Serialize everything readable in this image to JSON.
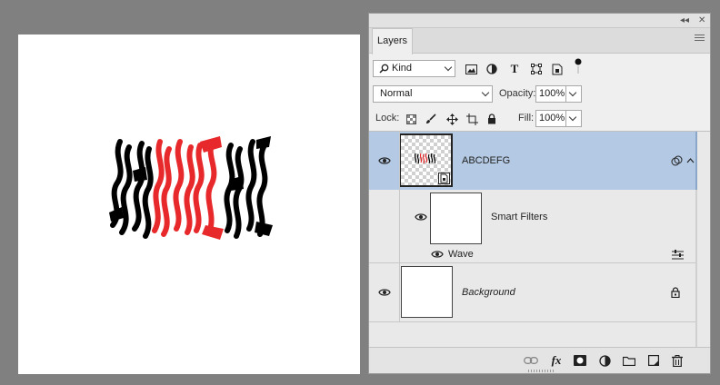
{
  "panel": {
    "collapse_glyph": "◂◂",
    "close_glyph": "✕",
    "tab_label": "Layers",
    "menu_icon": "hamburger-icon"
  },
  "filter_row": {
    "kind_label": "Kind",
    "kind_icon": "search-icon",
    "filter_icons": [
      "image-filter-icon",
      "adjustment-filter-icon",
      "type-filter-icon",
      "shape-filter-icon",
      "smart-object-filter-icon",
      "filter-toggle-icon"
    ]
  },
  "blend_row": {
    "mode": "Normal",
    "opacity_label": "Opacity:",
    "opacity_value": "100%"
  },
  "lock_row": {
    "lock_label": "Lock:",
    "lock_icons": [
      "lock-transparent-pixels-icon",
      "lock-image-pixels-icon",
      "lock-position-icon",
      "lock-artboard-icon",
      "lock-all-icon"
    ],
    "fill_label": "Fill:",
    "fill_value": "100%"
  },
  "layers": [
    {
      "name": "ABCDEFG",
      "selected": true,
      "visible": true,
      "type": "smart-object"
    },
    {
      "name": "Smart Filters",
      "visible": true,
      "type": "smart-filters"
    },
    {
      "name": "Wave",
      "visible": true,
      "type": "filter"
    },
    {
      "name": "Background",
      "visible": true,
      "locked": true,
      "type": "background"
    }
  ],
  "footer_icons": [
    "link-layers-icon",
    "fx-icon",
    "layer-mask-icon",
    "adjustment-layer-icon",
    "group-folder-icon",
    "new-layer-icon",
    "trash-icon"
  ],
  "colors": {
    "selection": "#b4c9e3",
    "canvas_red": "#e8292b",
    "canvas_black": "#000000"
  }
}
